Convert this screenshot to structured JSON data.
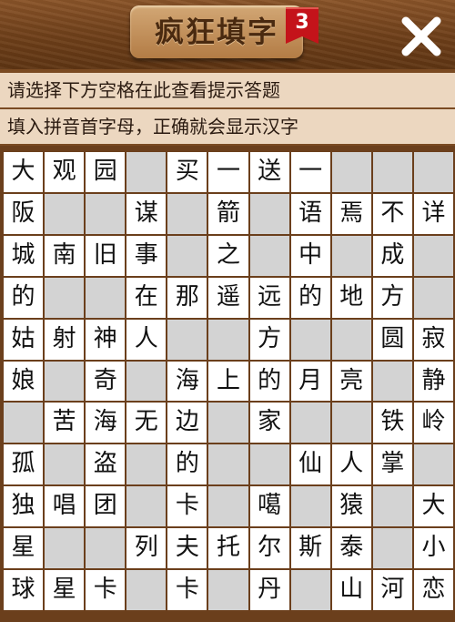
{
  "header": {
    "title": "疯狂填字",
    "level": "3",
    "close_icon": "close-icon"
  },
  "hints": {
    "line1": "请选择下方空格在此查看提示答题",
    "line2": "填入拼音首字母，正确就会显示汉字"
  },
  "colors": {
    "wood": "#7a4a22",
    "hint_bg": "#ecd7c0",
    "cell_filled": "#ffffff",
    "cell_empty": "#d3d3d3",
    "badge": "#c4131a"
  },
  "grid": [
    [
      "大",
      "观",
      "园",
      "",
      "买",
      "一",
      "送",
      "一",
      "",
      "",
      ""
    ],
    [
      "阪",
      "",
      "",
      "谋",
      "",
      "箭",
      "",
      "语",
      "焉",
      "不",
      "详"
    ],
    [
      "城",
      "南",
      "旧",
      "事",
      "",
      "之",
      "",
      "中",
      "",
      "成",
      ""
    ],
    [
      "的",
      "",
      "",
      "在",
      "那",
      "遥",
      "远",
      "的",
      "地",
      "方",
      ""
    ],
    [
      "姑",
      "射",
      "神",
      "人",
      "",
      "",
      "方",
      "",
      "",
      "圆",
      "寂"
    ],
    [
      "娘",
      "",
      "奇",
      "",
      "海",
      "上",
      "的",
      "月",
      "亮",
      "",
      "静"
    ],
    [
      "",
      "苦",
      "海",
      "无",
      "边",
      "",
      "家",
      "",
      "",
      "铁",
      "岭"
    ],
    [
      "孤",
      "",
      "盗",
      "",
      "的",
      "",
      "",
      "仙",
      "人",
      "掌",
      ""
    ],
    [
      "独",
      "唱",
      "团",
      "",
      "卡",
      "",
      "噶",
      "",
      "猿",
      "",
      "大"
    ],
    [
      "星",
      "",
      "",
      "列",
      "夫",
      "托",
      "尔",
      "斯",
      "泰",
      "",
      "小"
    ],
    [
      "球",
      "星",
      "卡",
      "",
      "卡",
      "",
      "丹",
      "",
      "山",
      "河",
      "恋"
    ]
  ]
}
